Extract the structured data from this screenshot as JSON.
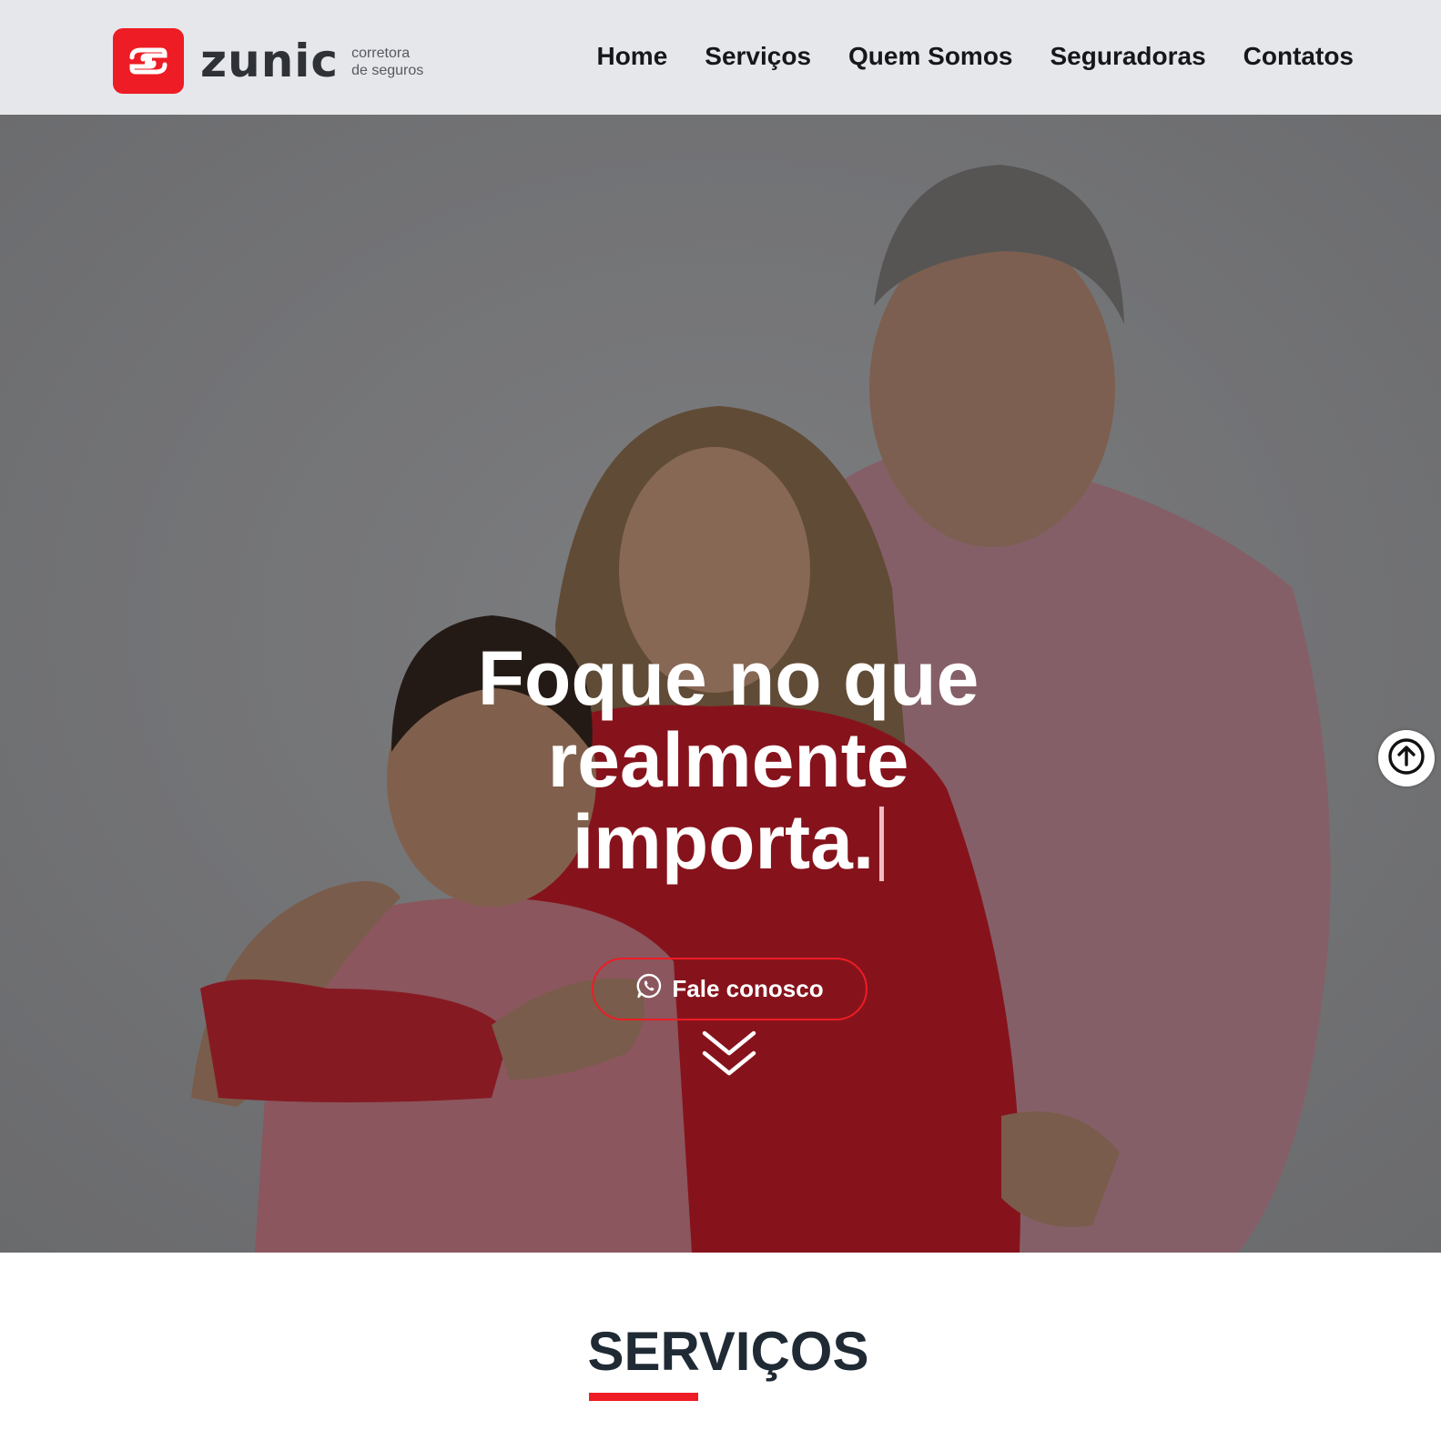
{
  "header": {
    "logo": {
      "name": "zunic",
      "subtitle_line1": "corretora",
      "subtitle_line2": "de seguros"
    },
    "nav": [
      {
        "label": "Home"
      },
      {
        "label": "Serviços"
      },
      {
        "label": "Quem Somos"
      },
      {
        "label": "Seguradoras"
      },
      {
        "label": "Contatos"
      }
    ]
  },
  "hero": {
    "title_lines": [
      "Foque no que",
      "realmente",
      "importa."
    ],
    "cta_label": "Fale conosco",
    "cta_icon": "whatsapp-icon",
    "scroll_icon": "double-chevron-down-icon",
    "back_to_top_icon": "arrow-up-circle-icon"
  },
  "services": {
    "title": "SERVIÇOS"
  },
  "colors": {
    "brand_red": "#ee1c24",
    "header_bg": "#e6e7eb",
    "dark_text": "#1f2a34"
  }
}
